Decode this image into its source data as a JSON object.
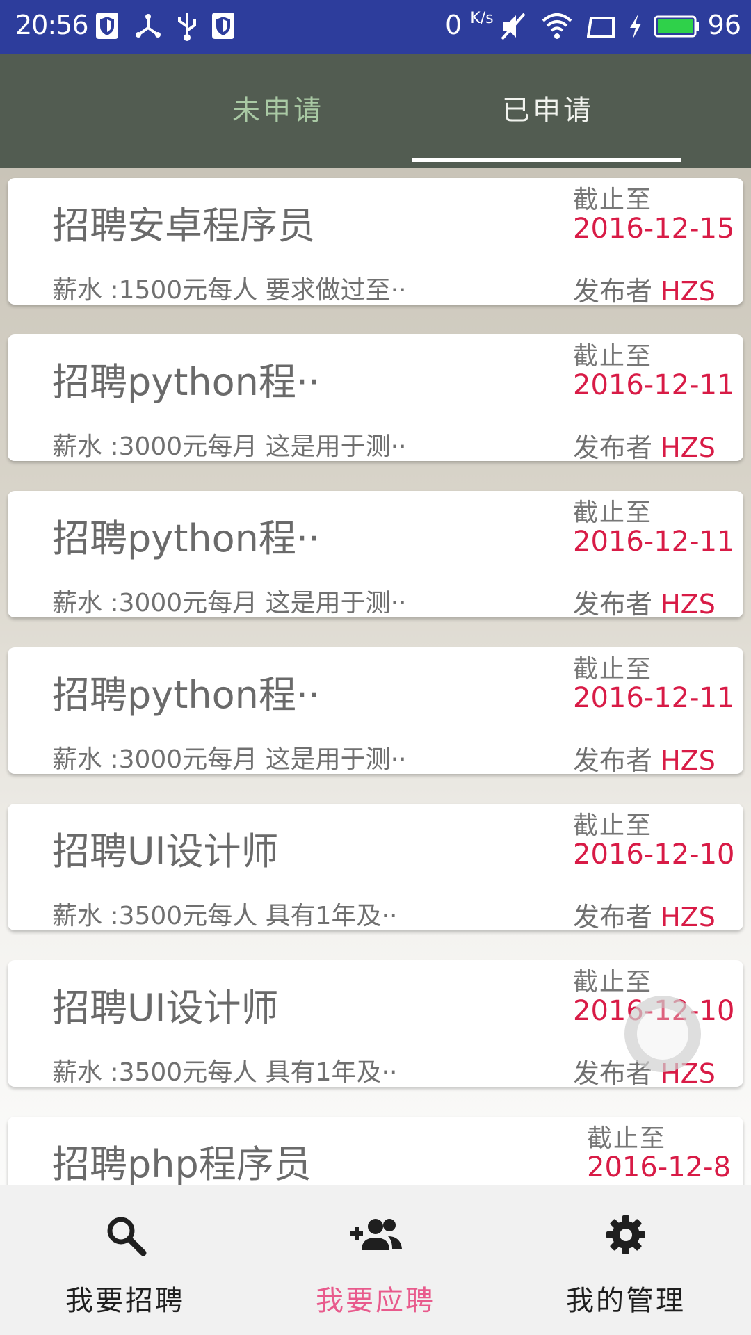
{
  "status_bar": {
    "time": "20:56",
    "net_speed": "0",
    "net_speed_unit": "K/s",
    "battery_percent": "96",
    "icons": [
      "shield-icon",
      "usb-tree-icon",
      "usb-icon",
      "shield-icon",
      "mute-icon",
      "wifi-icon",
      "screen-icon",
      "charging-icon",
      "battery-icon"
    ]
  },
  "tabs": {
    "items": [
      {
        "label": "未申请",
        "selected": false
      },
      {
        "label": "已申请",
        "selected": true
      }
    ]
  },
  "jobs": [
    {
      "title": "招聘安卓程序员",
      "desc": "薪水 :1500元每人  要求做过至··",
      "deadline_label": "截止至",
      "date": "2016-12-15",
      "publisher_label": "发布者",
      "publisher": "HZS"
    },
    {
      "title": "招聘python程··",
      "desc": "薪水 :3000元每月  这是用于测··",
      "deadline_label": "截止至",
      "date": "2016-12-11",
      "publisher_label": "发布者",
      "publisher": "HZS"
    },
    {
      "title": "招聘python程··",
      "desc": "薪水 :3000元每月  这是用于测··",
      "deadline_label": "截止至",
      "date": "2016-12-11",
      "publisher_label": "发布者",
      "publisher": "HZS"
    },
    {
      "title": "招聘python程··",
      "desc": "薪水 :3000元每月  这是用于测··",
      "deadline_label": "截止至",
      "date": "2016-12-11",
      "publisher_label": "发布者",
      "publisher": "HZS"
    },
    {
      "title": "招聘UI设计师",
      "desc": "薪水 :3500元每人  具有1年及··",
      "deadline_label": "截止至",
      "date": "2016-12-10",
      "publisher_label": "发布者",
      "publisher": "HZS"
    },
    {
      "title": "招聘UI设计师",
      "desc": "薪水 :3500元每人  具有1年及··",
      "deadline_label": "截止至",
      "date": "2016-12-10",
      "publisher_label": "发布者",
      "publisher": "HZS"
    },
    {
      "title": "招聘php程序员",
      "deadline_label": "截止至",
      "date": "2016-12-8"
    }
  ],
  "bottom_nav": {
    "items": [
      {
        "label": "我要招聘",
        "icon": "search-icon",
        "active": false
      },
      {
        "label": "我要应聘",
        "icon": "add-people-icon",
        "active": true
      },
      {
        "label": "我的管理",
        "icon": "gear-icon",
        "active": false
      }
    ]
  },
  "colors": {
    "status_bar": "#2d3d9c",
    "tab_bar": "#525c51",
    "accent_red": "#d81b46",
    "active_nav": "#e85a8c"
  }
}
